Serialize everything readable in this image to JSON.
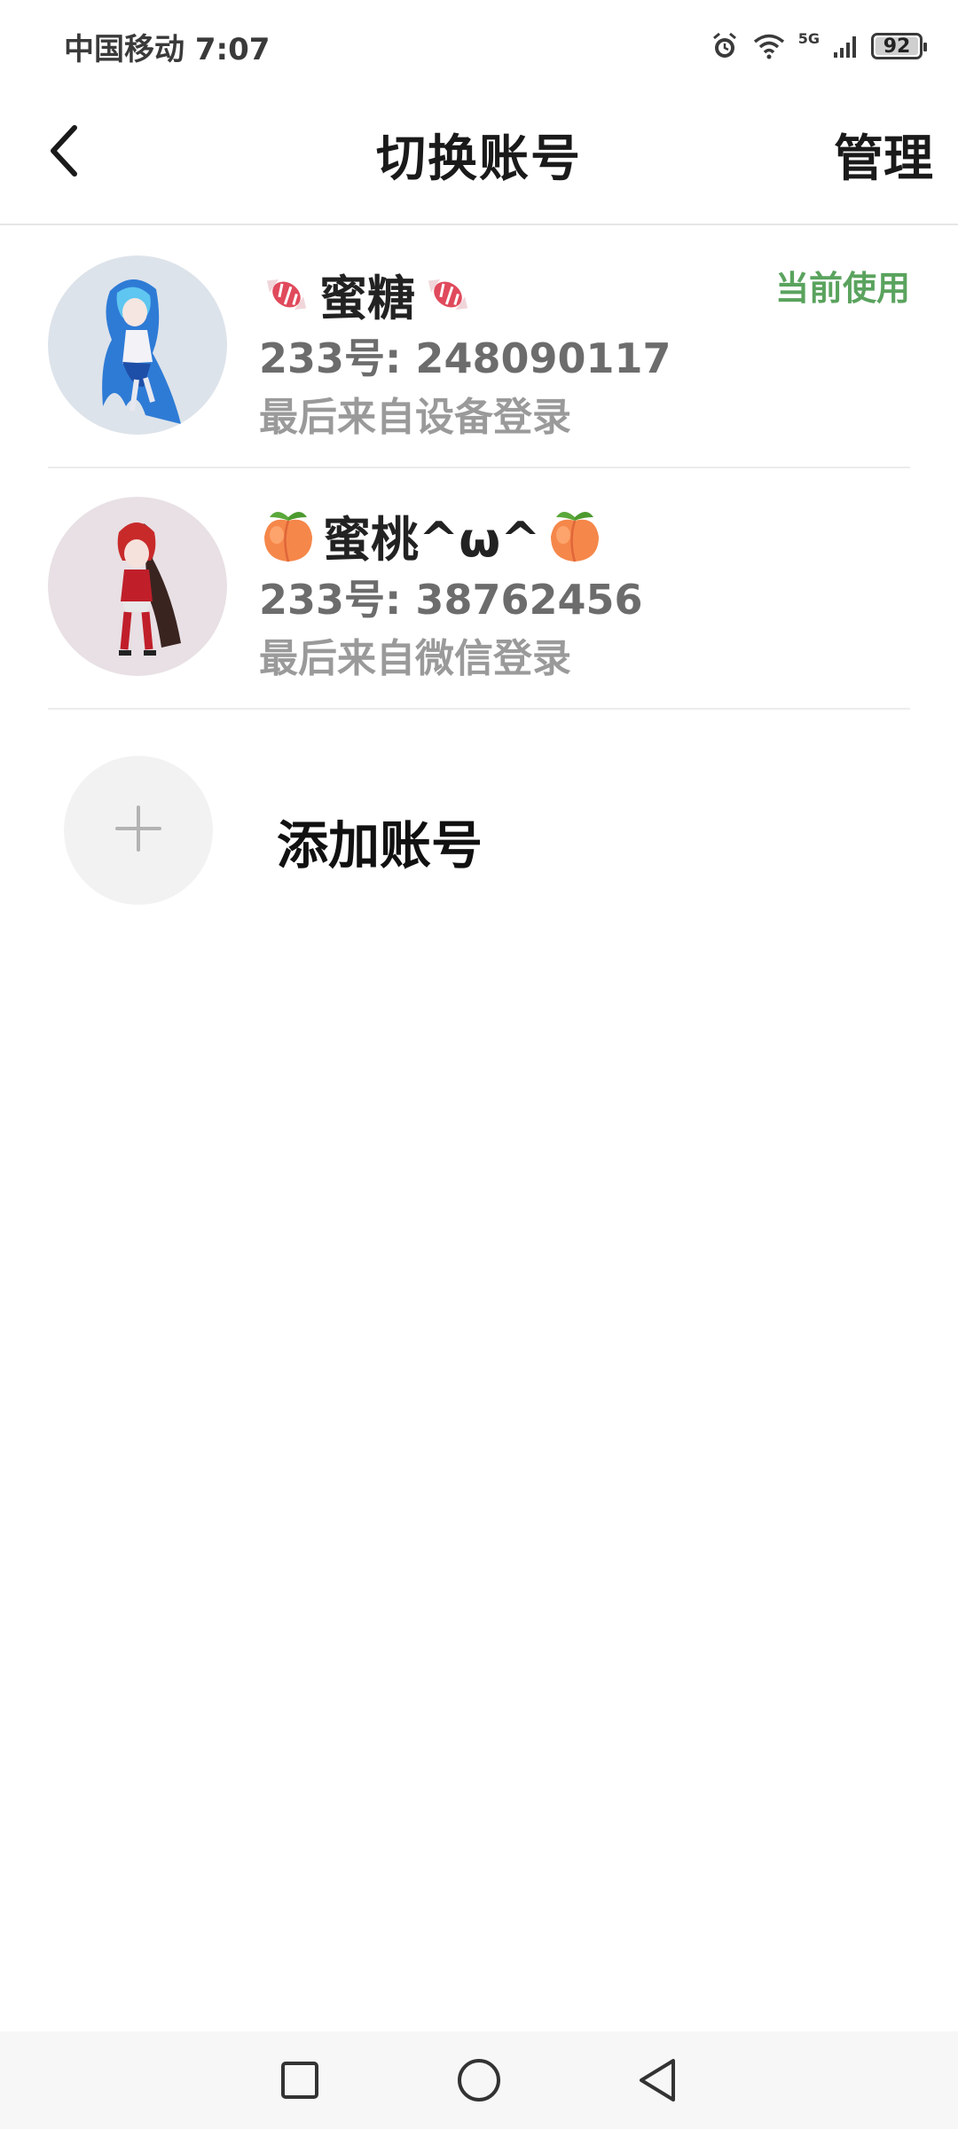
{
  "status_bar": {
    "carrier_time": "中国移动 7:07",
    "network": "5G",
    "battery": 92
  },
  "header": {
    "title": "切换账号",
    "manage_label": "管理"
  },
  "accounts": [
    {
      "name": "蜜糖",
      "name_emoji": "candy",
      "id": "233号: 248090117",
      "login": "最后来自设备登录",
      "status": "当前使用"
    },
    {
      "name": "蜜桃^ω^",
      "name_emoji": "peach",
      "id": "233号: 38762456",
      "login": "最后来自微信登录"
    }
  ],
  "add_account": {
    "label": "添加账号"
  },
  "icons": {
    "back": "chevron-left-icon",
    "add": "plus-icon",
    "nav_recent": "square-icon",
    "nav_home": "circle-icon",
    "nav_back": "triangle-left-icon"
  },
  "colors": {
    "accent_green": "#5aa35e",
    "divider": "#e6e6e6"
  }
}
